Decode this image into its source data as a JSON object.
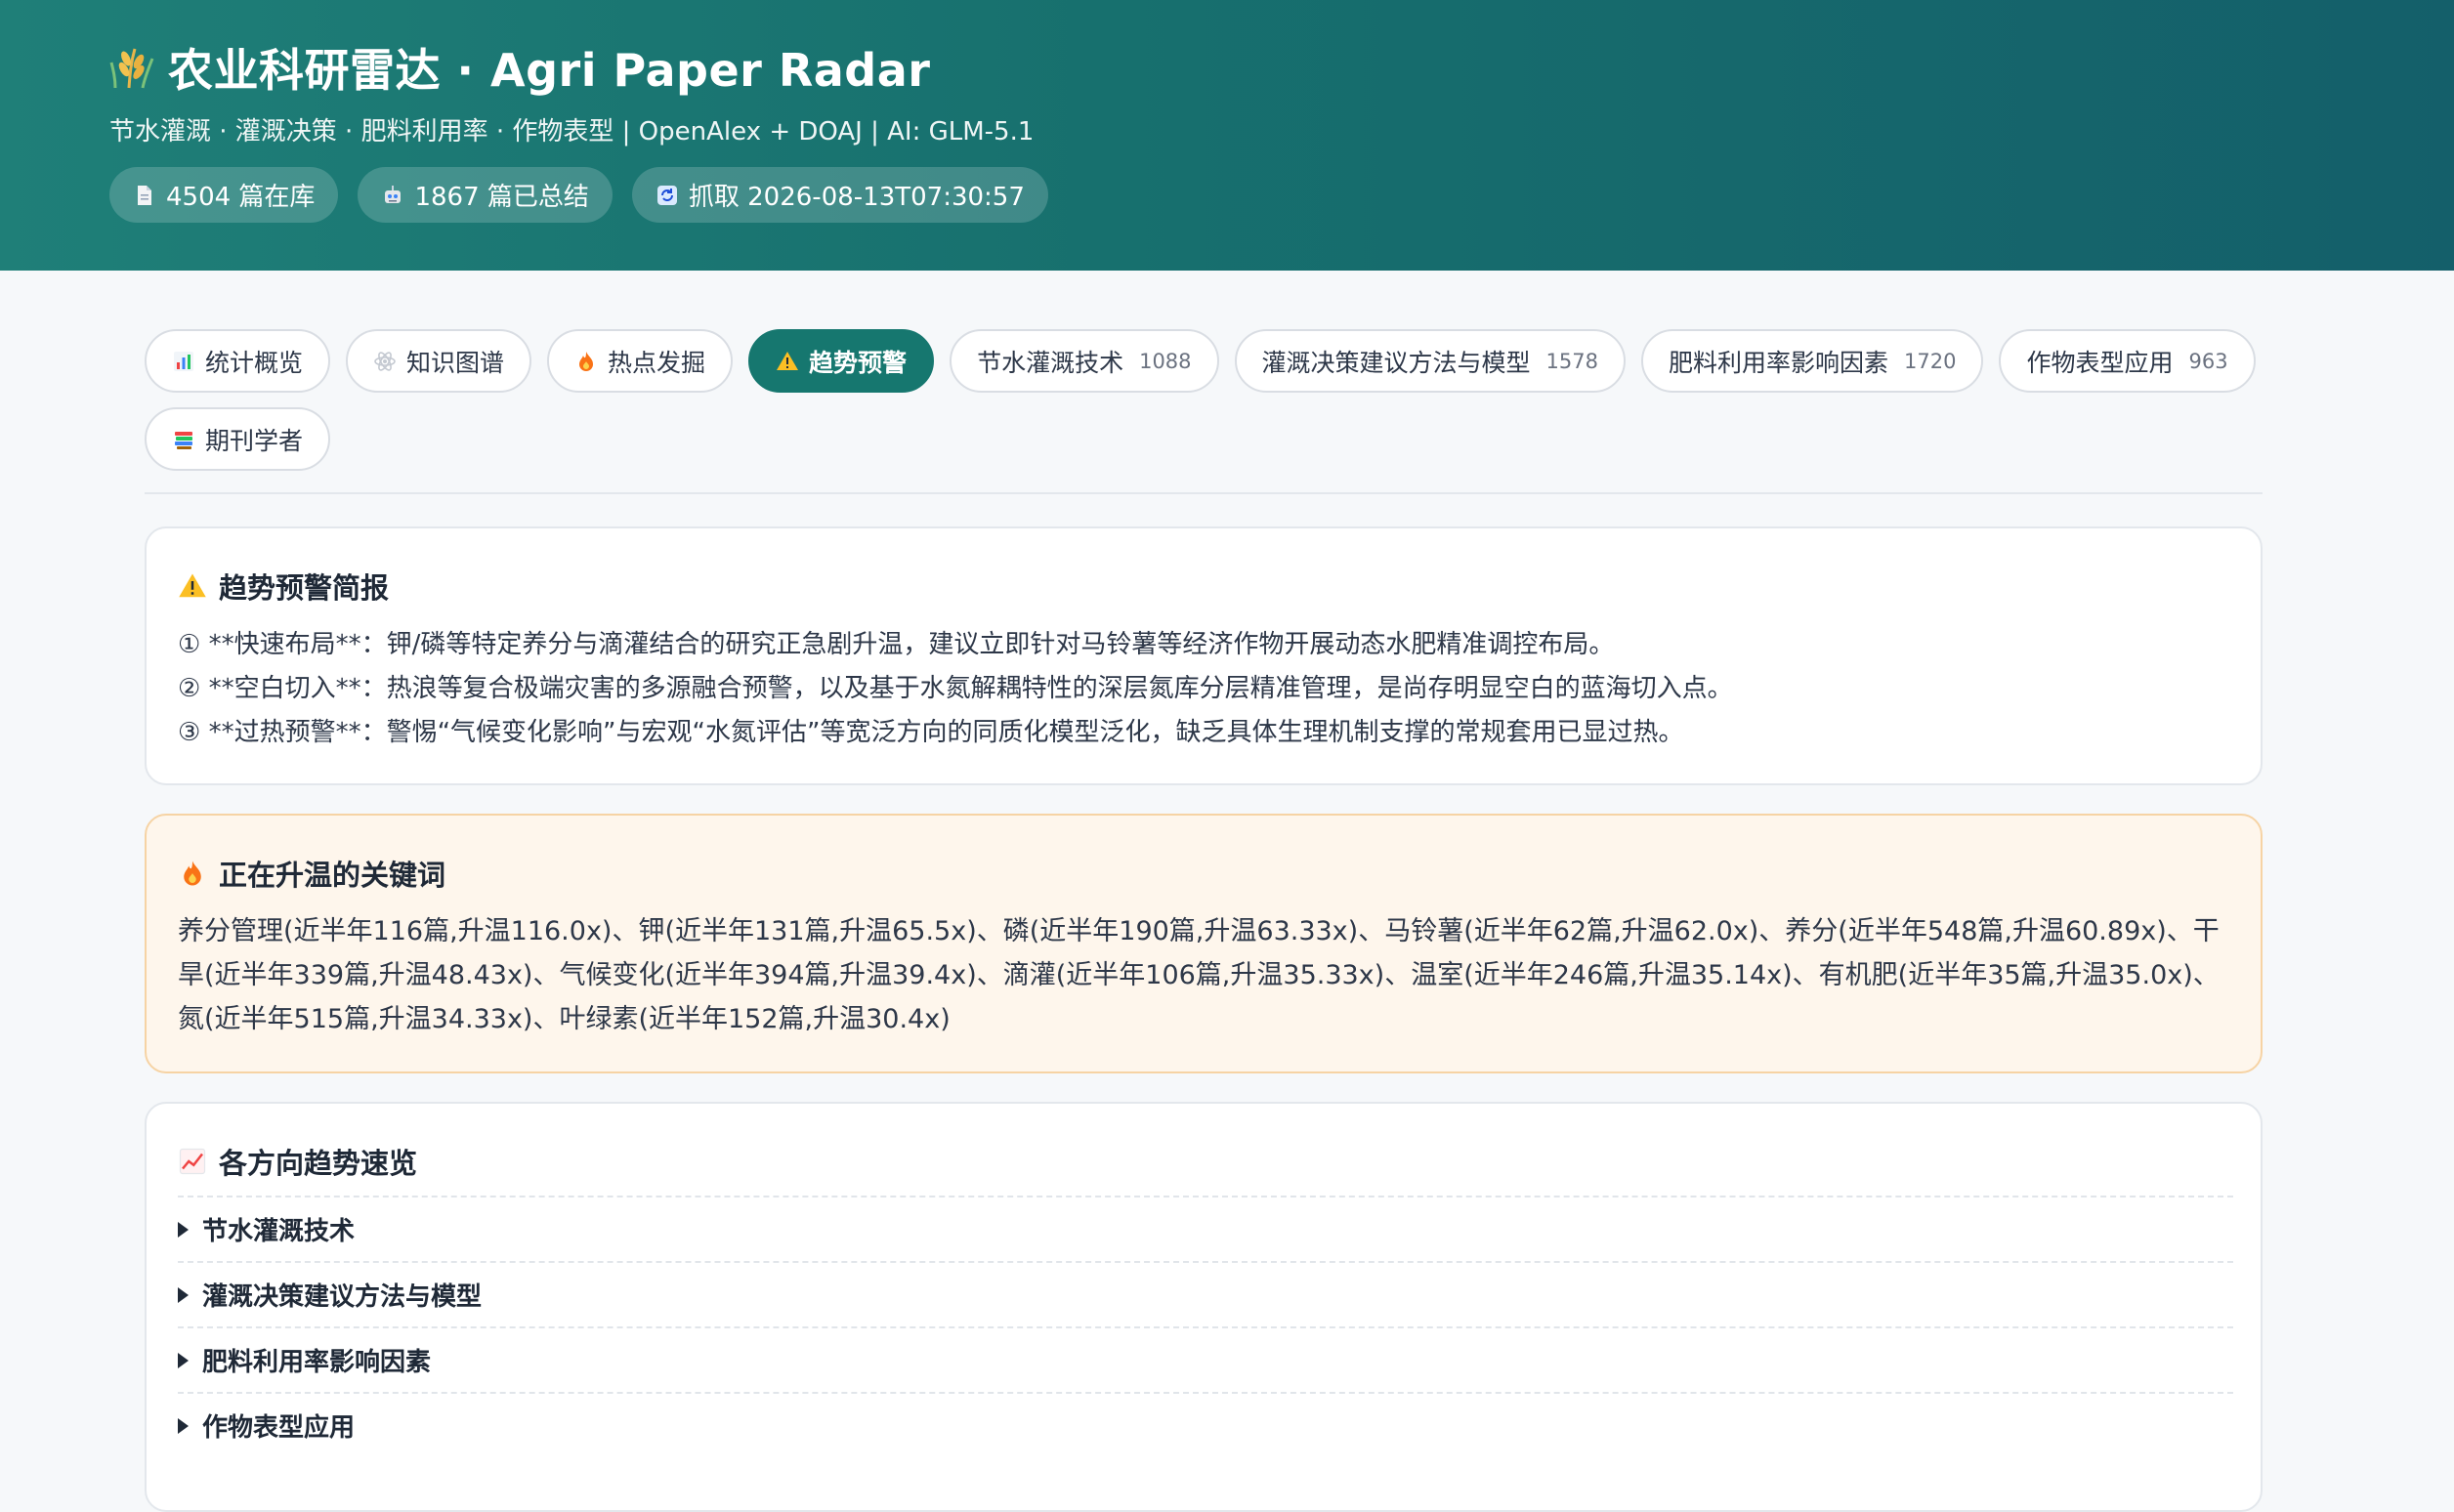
{
  "header": {
    "title": "农业科研雷达 · Agri Paper Radar",
    "subtitle": "节水灌溉 · 灌溉决策 · 肥料利用率 · 作物表型  |  OpenAlex + DOAJ  |  AI: GLM-5.1",
    "pills": [
      {
        "icon": "document-icon",
        "label": "4504 篇在库"
      },
      {
        "icon": "robot-icon",
        "label": "1867 篇已总结"
      },
      {
        "icon": "refresh-icon",
        "label": "抓取 2026-08-13T07:30:57"
      }
    ]
  },
  "tabs": [
    {
      "icon": "bar-chart-icon",
      "label": "统计概览",
      "count": ""
    },
    {
      "icon": "atom-icon",
      "label": "知识图谱",
      "count": ""
    },
    {
      "icon": "fire-icon",
      "label": "热点发掘",
      "count": ""
    },
    {
      "icon": "warning-icon",
      "label": "趋势预警",
      "count": "",
      "active": true
    },
    {
      "icon": "",
      "label": "节水灌溉技术",
      "count": "1088"
    },
    {
      "icon": "",
      "label": "灌溉决策建议方法与模型",
      "count": "1578"
    },
    {
      "icon": "",
      "label": "肥料利用率影响因素",
      "count": "1720"
    },
    {
      "icon": "",
      "label": "作物表型应用",
      "count": "963"
    },
    {
      "icon": "books-icon",
      "label": "期刊学者",
      "count": ""
    }
  ],
  "brief": {
    "title": "趋势预警简报",
    "lines": [
      "① **快速布局**：钾/磷等特定养分与滴灌结合的研究正急剧升温，建议立即针对马铃薯等经济作物开展动态水肥精准调控布局。",
      "② **空白切入**：热浪等复合极端灾害的多源融合预警，以及基于水氮解耦特性的深层氮库分层精准管理，是尚存明显空白的蓝海切入点。",
      "③ **过热预警**：警惕“气候变化影响”与宏观“水氮评估”等宽泛方向的同质化模型泛化，缺乏具体生理机制支撑的常规套用已显过热。"
    ]
  },
  "hot": {
    "title": "正在升温的关键词",
    "text": "养分管理(近半年116篇,升温116.0x)、钾(近半年131篇,升温65.5x)、磷(近半年190篇,升温63.33x)、马铃薯(近半年62篇,升温62.0x)、养分(近半年548篇,升温60.89x)、干旱(近半年339篇,升温48.43x)、气候变化(近半年394篇,升温39.4x)、滴灌(近半年106篇,升温35.33x)、温室(近半年246篇,升温35.14x)、有机肥(近半年35篇,升温35.0x)、氮(近半年515篇,升温34.33x)、叶绿素(近半年152篇,升温30.4x)"
  },
  "trends": {
    "title": "各方向趋势速览",
    "items": [
      "节水灌溉技术",
      "灌溉决策建议方法与模型",
      "肥料利用率影响因素",
      "作物表型应用"
    ]
  },
  "colors": {
    "header_start": "#1f7f78",
    "header_end": "#145f6a",
    "accent": "#16776f",
    "warm_bg": "#fef6ec",
    "warm_border": "#f6d3a4"
  }
}
